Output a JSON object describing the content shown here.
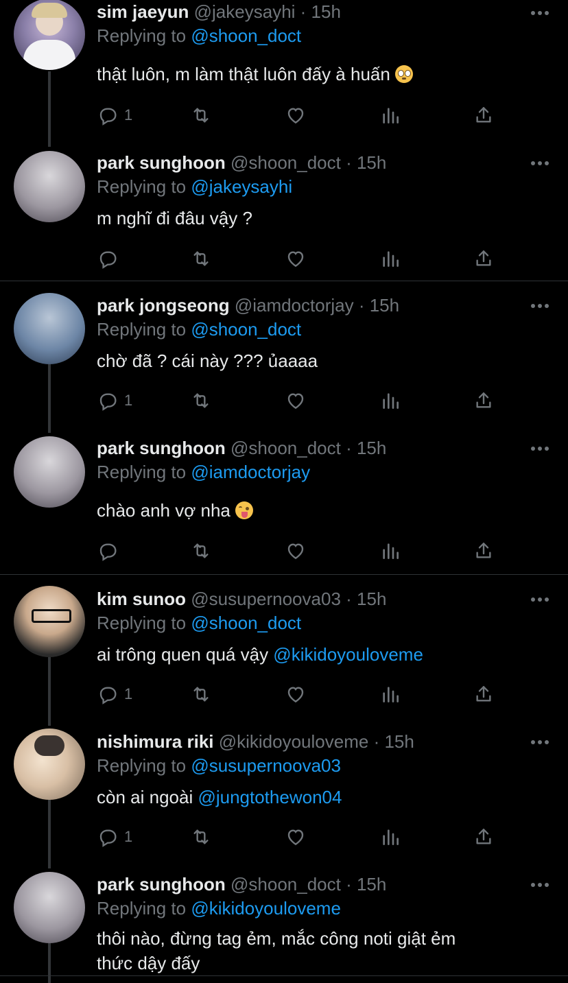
{
  "tweets": [
    {
      "name": "sim jaeyun",
      "handle": "@jakeysayhi",
      "time": "· 15h",
      "replying_prefix": "Replying to",
      "replying_to": "@shoon_doct",
      "text": "thật luôn, m làm thật luôn đấy à huấn",
      "emoji": "flushed-emoji",
      "reply_count": "1"
    },
    {
      "name": "park sunghoon",
      "handle": "@shoon_doct",
      "time": "· 15h",
      "replying_prefix": "Replying to",
      "replying_to": "@jakeysayhi",
      "text": "m nghĩ đi đâu vậy ?",
      "reply_count": ""
    },
    {
      "name": "park jongseong",
      "handle": "@iamdoctorjay",
      "time": "· 15h",
      "replying_prefix": "Replying to",
      "replying_to": "@shoon_doct",
      "text": "chờ đã ? cái này ??? ủaaaa",
      "reply_count": "1"
    },
    {
      "name": "park sunghoon",
      "handle": "@shoon_doct",
      "time": "· 15h",
      "replying_prefix": "Replying to",
      "replying_to": "@iamdoctorjay",
      "text": "chào anh vợ nha",
      "emoji": "tongue-out-emoji",
      "reply_count": ""
    },
    {
      "name": "kim sunoo",
      "handle": "@susupernoova03",
      "time": "· 15h",
      "replying_prefix": "Replying to",
      "replying_to": "@shoon_doct",
      "text": "ai trông quen quá vậy ",
      "text_mention": "@kikidoyouloveme",
      "reply_count": "1"
    },
    {
      "name": "nishimura riki",
      "handle": "@kikidoyouloveme",
      "time": "· 15h",
      "replying_prefix": "Replying to",
      "replying_to": "@susupernoova03",
      "text": "còn ai ngoài ",
      "text_mention": "@jungtothewon04",
      "reply_count": "1"
    },
    {
      "name": "park sunghoon",
      "handle": "@shoon_doct",
      "time": "· 15h",
      "replying_prefix": "Replying to",
      "replying_to": "@kikidoyouloveme",
      "text_line1": "thôi nào, đừng tag ẻm, mắc công noti giật ẻm",
      "text_line2": "thức dậy đấy",
      "reply_count": ""
    }
  ],
  "icons": [
    "reply-icon",
    "retweet-icon",
    "like-icon",
    "views-icon",
    "share-icon",
    "more-icon"
  ],
  "colors": {
    "background": "#000000",
    "text": "#e7e9ea",
    "secondary": "#71767b",
    "link": "#1d9bf0",
    "divider": "#2f3336"
  }
}
